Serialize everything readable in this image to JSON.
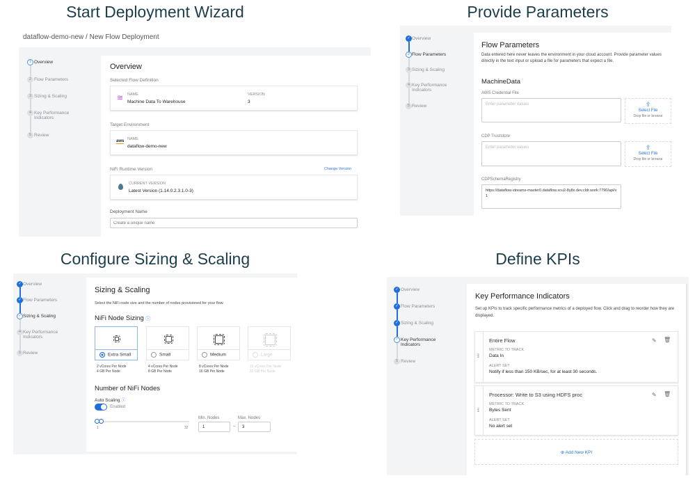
{
  "panels": {
    "start": {
      "title": "Start Deployment Wizard",
      "breadcrumb": "dataflow-demo-new / New Flow Deployment",
      "heading": "Overview",
      "selected_flow_label": "Selected Flow Definition",
      "flow_name_caption": "NAME",
      "flow_name": "Machine Data To Warehouse",
      "version_caption": "VERSION",
      "version": "3",
      "target_env_label": "Target Environment",
      "env_name_caption": "NAME",
      "env_name": "dataflow-demo-new",
      "env_icon_text": "aws",
      "runtime_label": "NiFi Runtime Version",
      "change_version": "Change Version",
      "current_version_caption": "CURRENT VERSION",
      "current_version": "Latest Version (1.14.0.2.3.1.0-3)",
      "deployment_name_label": "Deployment Name",
      "deployment_name_placeholder": "Create a unique name"
    },
    "params": {
      "title": "Provide Parameters",
      "heading": "Flow Parameters",
      "description": "Data entered here never leaves the environment in your cloud account. Provide parameter values directly in the text input or upload a file for parameters that expect a file.",
      "group": "MachineData",
      "fields": [
        {
          "label": "AWS Credential File",
          "placeholder": "Enter parameter values",
          "value": "",
          "select_file": "Select File",
          "drop_hint": "Drop file or browse"
        },
        {
          "label": "CDP Truststore",
          "placeholder": "Enter parameter values",
          "value": "",
          "select_file": "Select File",
          "drop_hint": "Drop file or browse"
        },
        {
          "label": "CDPSchemaRegistry",
          "placeholder": "",
          "value": "https://dataflow-streams-master0.dataflow.xcu2-8y8x.dev.cldr.work:7790/api/v1"
        }
      ]
    },
    "sizing": {
      "title": "Configure Sizing & Scaling",
      "heading": "Sizing & Scaling",
      "description": "Select the NiFi node size and the number of nodes provisioned for your flow.",
      "node_sizing_label": "NiFi Node Sizing",
      "sizes": [
        {
          "label": "Extra Small",
          "cores": "2 vCores Per Node",
          "mem": "4 GB Per Node",
          "selected": true,
          "disabled": false
        },
        {
          "label": "Small",
          "cores": "4 vCores Per Node",
          "mem": "8 GB Per Node",
          "selected": false,
          "disabled": false
        },
        {
          "label": "Medium",
          "cores": "8 vCores Per Node",
          "mem": "16 GB Per Node",
          "selected": false,
          "disabled": false
        },
        {
          "label": "Large",
          "cores": "16 vCores Per Node",
          "mem": "32 GB Per Node",
          "selected": false,
          "disabled": true
        }
      ],
      "nodes_label": "Number of NiFi Nodes",
      "auto_scaling_label": "Auto Scaling",
      "toggle_label": "Enabled",
      "toggle_on": true,
      "slider_min_label": "1",
      "slider_max_label": "32",
      "min_nodes_label": "Min. Nodes",
      "min_nodes": "1",
      "range_sep": "–",
      "max_nodes_label": "Max. Nodes",
      "max_nodes": "3"
    },
    "kpis": {
      "title": "Define KPIs",
      "heading": "Key Performance Indicators",
      "description": "Set up KPIs to track specific performance metrics of a deployed flow. Click and drag to reorder how they are displayed.",
      "items": [
        {
          "scope": "Entire Flow",
          "metric_caption": "METRIC TO TRACK",
          "metric": "Data In",
          "alert_caption": "ALERT SET",
          "alert": "Notify if less than 150 KB/sec, for at least 30 seconds."
        },
        {
          "scope": "Processor: Write to S3 using HDFS proc",
          "metric_caption": "METRIC TO TRACK",
          "metric": "Bytes Sent",
          "alert_caption": "ALERT SET",
          "alert": "No alert set"
        }
      ],
      "add_label": "Add New KPI"
    }
  },
  "steps": [
    "Overview",
    "Flow Parameters",
    "Sizing & Scaling",
    "Key Performance Indicators",
    "Review"
  ],
  "step_numbers": [
    "1",
    "2",
    "3",
    "4",
    "5"
  ],
  "colors": {
    "accent": "#1f6fd8",
    "title": "#1d3d4c",
    "panel_bg": "#f3f4f6"
  }
}
